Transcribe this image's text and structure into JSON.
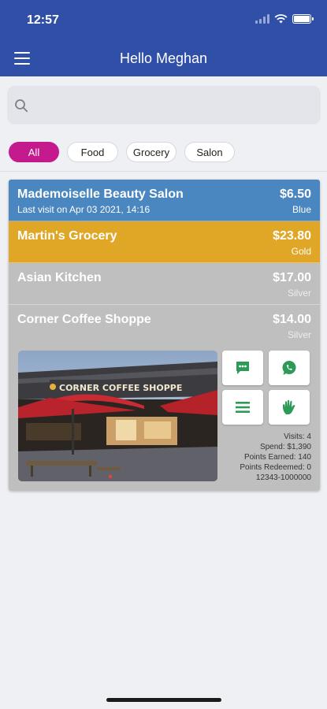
{
  "status": {
    "time": "12:57"
  },
  "header": {
    "title": "Hello Meghan"
  },
  "search": {
    "placeholder": ""
  },
  "filters": [
    "All",
    "Food",
    "Grocery",
    "Salon"
  ],
  "businesses": [
    {
      "name": "Mademoiselle Beauty Salon",
      "subtitle": "Last visit on Apr 03 2021, 14:16",
      "amount": "$6.50",
      "tier": "Blue",
      "color": "#4a86c0"
    },
    {
      "name": "Martin's Grocery",
      "amount": "$23.80",
      "tier": "Gold",
      "color": "#e0a626"
    },
    {
      "name": "Asian Kitchen",
      "amount": "$17.00",
      "tier": "Silver",
      "color": "#bfbfbf"
    },
    {
      "name": "Corner Coffee Shoppe",
      "amount": "$14.00",
      "tier": "Silver",
      "color": "#bfbfbf",
      "photo_sign": "CORNER COFFEE SHOPPE",
      "stats": {
        "visits": "Visits: 4",
        "spend": "Spend: $1,390",
        "earned": "Points Earned: 140",
        "redeemed": "Points Redeemed: 0",
        "account": "12343-1000000"
      }
    }
  ],
  "icons": {
    "menu": "hamburger-icon",
    "search": "search-icon",
    "chat": "chat-icon",
    "whatsapp": "whatsapp-icon",
    "list": "list-icon",
    "hand": "hand-icon"
  },
  "colors": {
    "header": "#3050a8",
    "accent": "#c41a8e",
    "action_icon": "#2e9a58"
  }
}
